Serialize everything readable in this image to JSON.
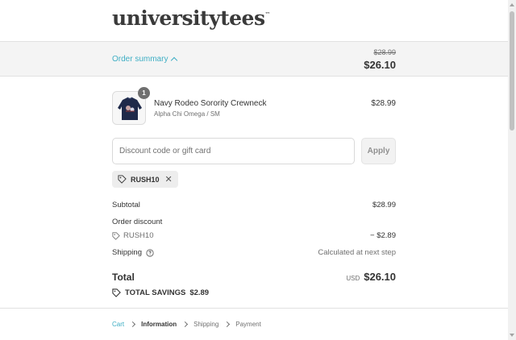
{
  "brand": {
    "logo_text": "universitytees",
    "trademark": "™"
  },
  "summary": {
    "toggle_label": "Order summary",
    "original_total": "$28.99",
    "total": "$26.10"
  },
  "product": {
    "quantity": "1",
    "name": "Navy Rodeo Sorority Crewneck",
    "variant": "Alpha Chi Omega / SM",
    "price": "$28.99"
  },
  "discount": {
    "placeholder": "Discount code or gift card",
    "apply_label": "Apply",
    "applied_code": "RUSH10"
  },
  "totals": {
    "subtotal_label": "Subtotal",
    "subtotal_value": "$28.99",
    "order_discount_label": "Order discount",
    "discount_code": "RUSH10",
    "discount_value": "− $2.89",
    "shipping_label": "Shipping",
    "shipping_value": "Calculated at next step",
    "total_label": "Total",
    "currency": "USD",
    "total_value": "$26.10",
    "savings_label": "TOTAL SAVINGS",
    "savings_value": "$2.89"
  },
  "breadcrumb": {
    "cart": "Cart",
    "information": "Information",
    "shipping": "Shipping",
    "payment": "Payment"
  },
  "colors": {
    "accent": "#3eaec4",
    "summary_bg": "#f4f4f4",
    "text": "#333333",
    "muted": "#707070"
  },
  "icons": [
    "chevron-up-icon",
    "tag-icon",
    "close-icon",
    "question-circle-icon",
    "chevron-right-icon",
    "sweater-thumbnail"
  ]
}
